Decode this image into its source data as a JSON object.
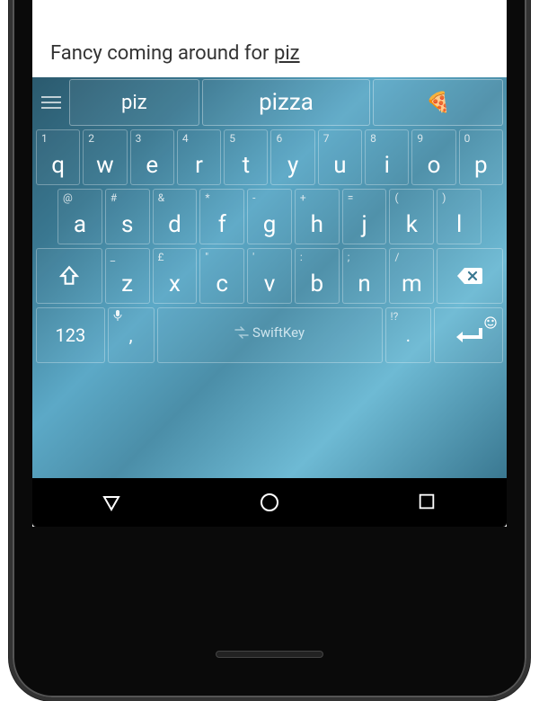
{
  "text_input": {
    "sentence": "Fancy coming around for ",
    "partial": "piz"
  },
  "suggestions": {
    "left": "piz",
    "center": "pizza",
    "right_emoji": "🍕"
  },
  "rows": {
    "r1": [
      {
        "main": "q",
        "sec": "1"
      },
      {
        "main": "w",
        "sec": "2"
      },
      {
        "main": "e",
        "sec": "3"
      },
      {
        "main": "r",
        "sec": "4"
      },
      {
        "main": "t",
        "sec": "5"
      },
      {
        "main": "y",
        "sec": "6"
      },
      {
        "main": "u",
        "sec": "7"
      },
      {
        "main": "i",
        "sec": "8"
      },
      {
        "main": "o",
        "sec": "9"
      },
      {
        "main": "p",
        "sec": "0"
      }
    ],
    "r2": [
      {
        "main": "a",
        "sec": "@"
      },
      {
        "main": "s",
        "sec": "#"
      },
      {
        "main": "d",
        "sec": "&"
      },
      {
        "main": "f",
        "sec": "*"
      },
      {
        "main": "g",
        "sec": "-"
      },
      {
        "main": "h",
        "sec": "+"
      },
      {
        "main": "j",
        "sec": "="
      },
      {
        "main": "k",
        "sec": "("
      },
      {
        "main": "l",
        "sec": ")"
      }
    ],
    "r3": [
      {
        "main": "z",
        "sec": "_"
      },
      {
        "main": "x",
        "sec": "£"
      },
      {
        "main": "c",
        "sec": "\""
      },
      {
        "main": "v",
        "sec": "'"
      },
      {
        "main": "b",
        "sec": ":"
      },
      {
        "main": "n",
        "sec": ";"
      },
      {
        "main": "m",
        "sec": "/"
      }
    ]
  },
  "fn": {
    "numeric": "123",
    "comma": ",",
    "period": ".",
    "punct_hint": "!?",
    "mic_hint": ""
  },
  "brand": "SwiftKey"
}
